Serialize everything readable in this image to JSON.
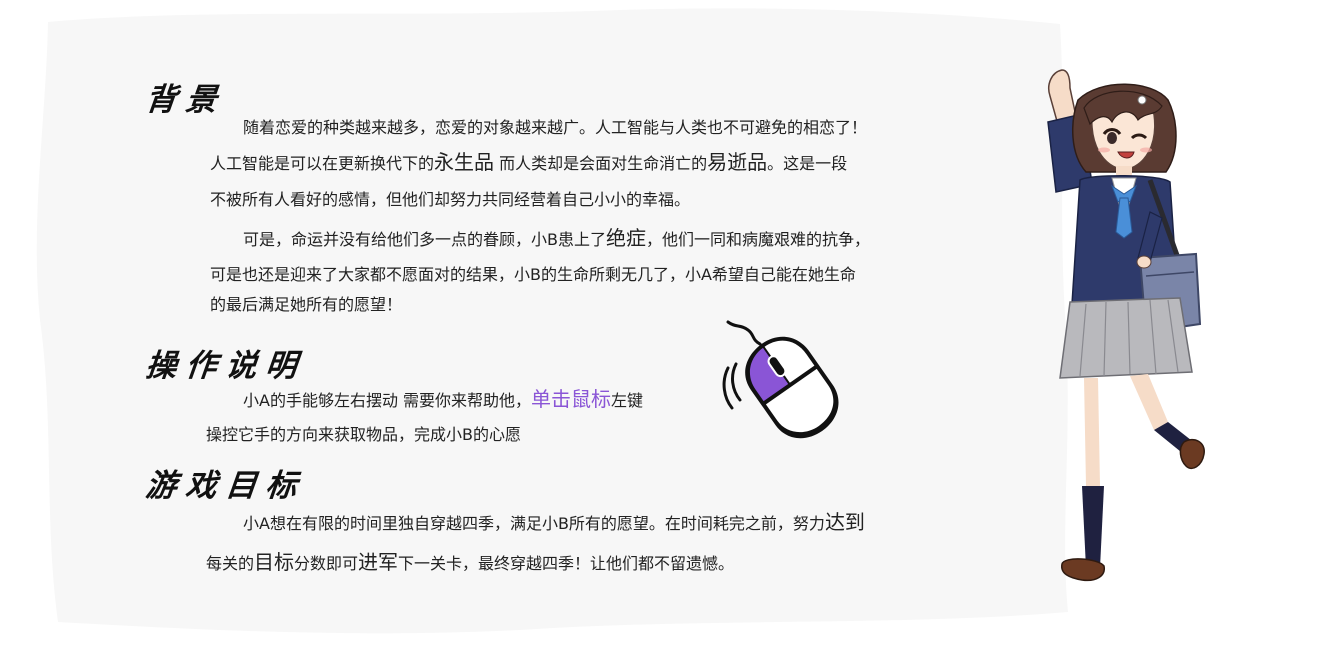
{
  "background_heading": "背景",
  "background_p1_intro": "随着恋爱的种类越来越多，恋爱的对象越来越广。人工智能与人类也不可避免的相恋了！",
  "background_p1_line2_a": "人工智能是可以在更新换代下的",
  "background_p1_line2_b": "永生品",
  "background_p1_line2_c": "而人类却是会面对生命消亡的",
  "background_p1_line2_d": "易逝品",
  "background_p1_line2_e": "。这是一段",
  "background_p1_line3": "不被所有人看好的感情，但他们却努力共同经营着自己小小的幸福。",
  "background_p2_line1_a": "可是，命运并没有给他们多一点的眷顾，小B患上了",
  "background_p2_line1_b": "绝症",
  "background_p2_line1_c": "，他们一同和病魔艰难的抗争，",
  "background_p2_line2": "可是也还是迎来了大家都不愿面对的结果，小B的生命所剩无几了，小A希望自己能在她生命",
  "background_p2_line3": "的最后满足她所有的愿望！",
  "controls_heading": "操作说明",
  "controls_line1_a": "小A的手能够左右摆动 需要你来帮助他，",
  "controls_line1_b": "单击鼠标",
  "controls_line1_c": "左键",
  "controls_line2": "操控它手的方向来获取物品，完成小B的心愿",
  "goal_heading": "游戏目标",
  "goal_line1_a": "小A想在有限的时间里独自穿越四季，满足小B所有的愿望。在时间耗完之前，努力",
  "goal_line1_b": "达到",
  "goal_line2_a": "每关的",
  "goal_line2_b": "目标",
  "goal_line2_c": "分数即可",
  "goal_line2_d": "进军",
  "goal_line2_e": "下一关卡，最终穿越四季！让他们都不留遗憾。",
  "colors": {
    "paper": "#f7f7f7",
    "accent_purple": "#8a55d6",
    "text": "#222222",
    "uniform_navy": "#2e3a6b",
    "skirt_gray": "#b9b9bd",
    "hair_brown": "#5a3b32"
  },
  "icons": {
    "mouse": "mouse-icon",
    "character": "schoolgirl-character"
  }
}
